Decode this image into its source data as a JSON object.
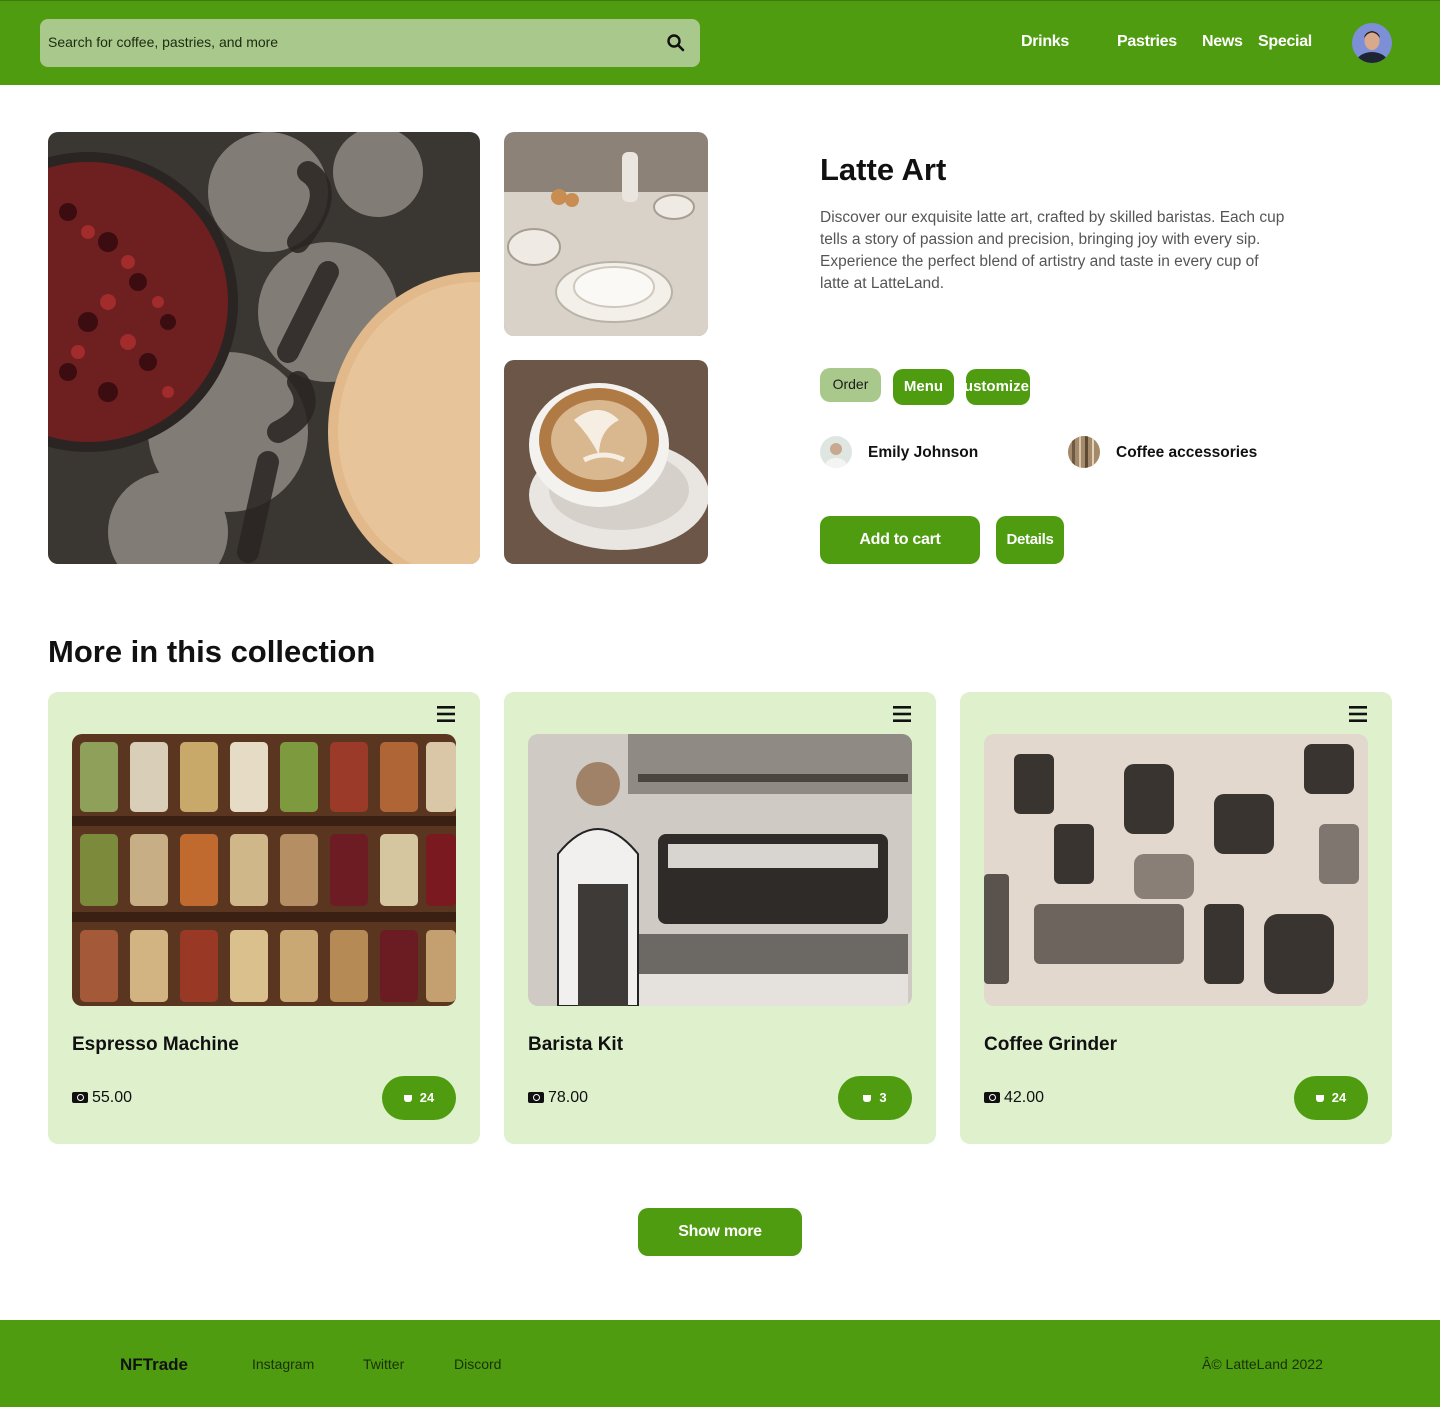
{
  "search": {
    "placeholder": "Search for coffee, pastries, and more"
  },
  "nav": {
    "items": [
      "Drinks",
      "Pastries",
      "News",
      "Special"
    ]
  },
  "product": {
    "title": "Latte Art",
    "description": "Discover our exquisite latte art, crafted by skilled baristas. Each cup tells a story of passion and precision, bringing joy with every sip. Experience the perfect blend of artistry and taste in every cup of latte at LatteLand.",
    "chips": [
      "Order",
      "Menu",
      "Customize"
    ],
    "creator": "Emily Johnson",
    "collection": "Coffee accessories",
    "add_to_cart": "Add to cart",
    "details": "Details"
  },
  "collection": {
    "title": "More in this collection",
    "items": [
      {
        "name": "Espresso Machine",
        "price": "55.00",
        "likes": "24"
      },
      {
        "name": "Barista Kit",
        "price": "78.00",
        "likes": "3"
      },
      {
        "name": "Coffee Grinder",
        "price": "42.00",
        "likes": "24"
      }
    ],
    "show_more": "Show more"
  },
  "footer": {
    "brand": "NFTrade",
    "links": [
      "Instagram",
      "Twitter",
      "Discord"
    ],
    "copyright": "Â© LatteLand 2022"
  },
  "colors": {
    "primary": "#4f9c10",
    "search_bg": "#a9c98c",
    "card_bg": "#dff0cd"
  },
  "icons": [
    "search-icon",
    "menu-icon",
    "cash-icon",
    "coffee-cup-icon",
    "avatar"
  ]
}
